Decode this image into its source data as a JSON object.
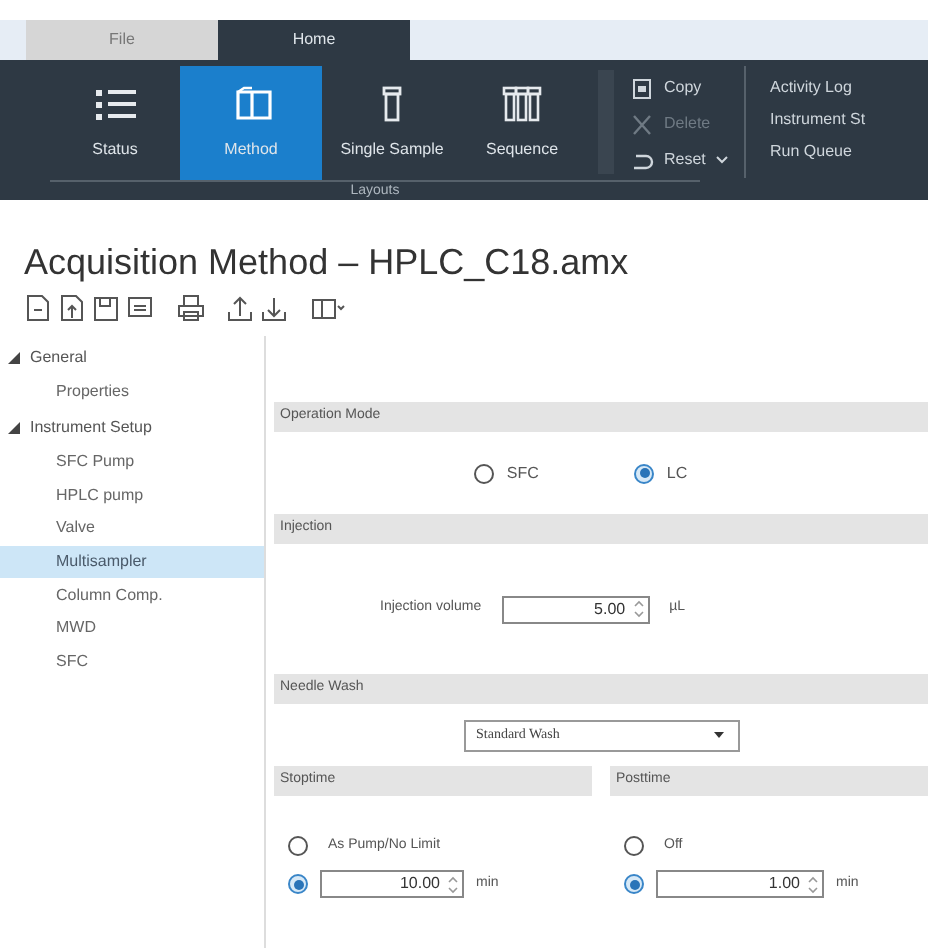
{
  "ribbon_tabs": [
    {
      "label": "File",
      "selected": false
    },
    {
      "label": "Home",
      "selected": true
    }
  ],
  "ribbon": {
    "large_buttons": [
      {
        "label": "Status",
        "kind": "list",
        "selected": false
      },
      {
        "label": "Method",
        "kind": "book",
        "selected": true
      },
      {
        "label": "Single Sample",
        "kind": "vial",
        "selected": false
      },
      {
        "label": "Sequence",
        "kind": "vials",
        "selected": false
      }
    ],
    "small_buttons": [
      {
        "label": "Copy",
        "kind": "copy",
        "disabled": false
      },
      {
        "label": "Delete",
        "kind": "delete",
        "disabled": true
      },
      {
        "label": "Reset",
        "kind": "reset",
        "disabled": false
      }
    ],
    "group_label": "Layouts",
    "links": [
      "Activity Log",
      "Instrument St",
      "Run Queue"
    ]
  },
  "title": "Acquisition Method – HPLC_C18.amx",
  "tree": [
    {
      "label": "General",
      "expanded": true,
      "selected": false,
      "children": [
        {
          "label": "Properties",
          "selected": false
        }
      ]
    },
    {
      "label": "Instrument Setup",
      "expanded": true,
      "selected": false,
      "children": [
        {
          "label": "SFC Pump",
          "selected": false
        },
        {
          "label": "HPLC pump",
          "selected": false
        },
        {
          "label": "Valve",
          "selected": false
        },
        {
          "label": "Multisampler",
          "selected": true
        },
        {
          "label": "Column Comp.",
          "selected": false
        },
        {
          "label": "MWD",
          "selected": false
        },
        {
          "label": "SFC",
          "selected": false
        }
      ]
    }
  ],
  "operation_mode": {
    "header": "Operation Mode",
    "options": [
      {
        "label": "SFC",
        "selected": false
      },
      {
        "label": "LC",
        "selected": true
      }
    ]
  },
  "injection": {
    "header": "Injection",
    "label": "Injection volume",
    "value": "5.00",
    "unit": "µL"
  },
  "needle_wash": {
    "header": "Needle Wash",
    "value": "Standard Wash"
  },
  "stoptime": {
    "header": "Stoptime",
    "options": [
      {
        "kind": "label",
        "label": "As Pump/No Limit",
        "selected": false
      },
      {
        "kind": "value",
        "value": "10.00",
        "unit": "min",
        "selected": true
      }
    ]
  },
  "posttime": {
    "header": "Posttime",
    "options": [
      {
        "kind": "label",
        "label": "Off",
        "selected": false
      },
      {
        "kind": "value",
        "value": "1.00",
        "unit": "min",
        "selected": true
      }
    ]
  }
}
